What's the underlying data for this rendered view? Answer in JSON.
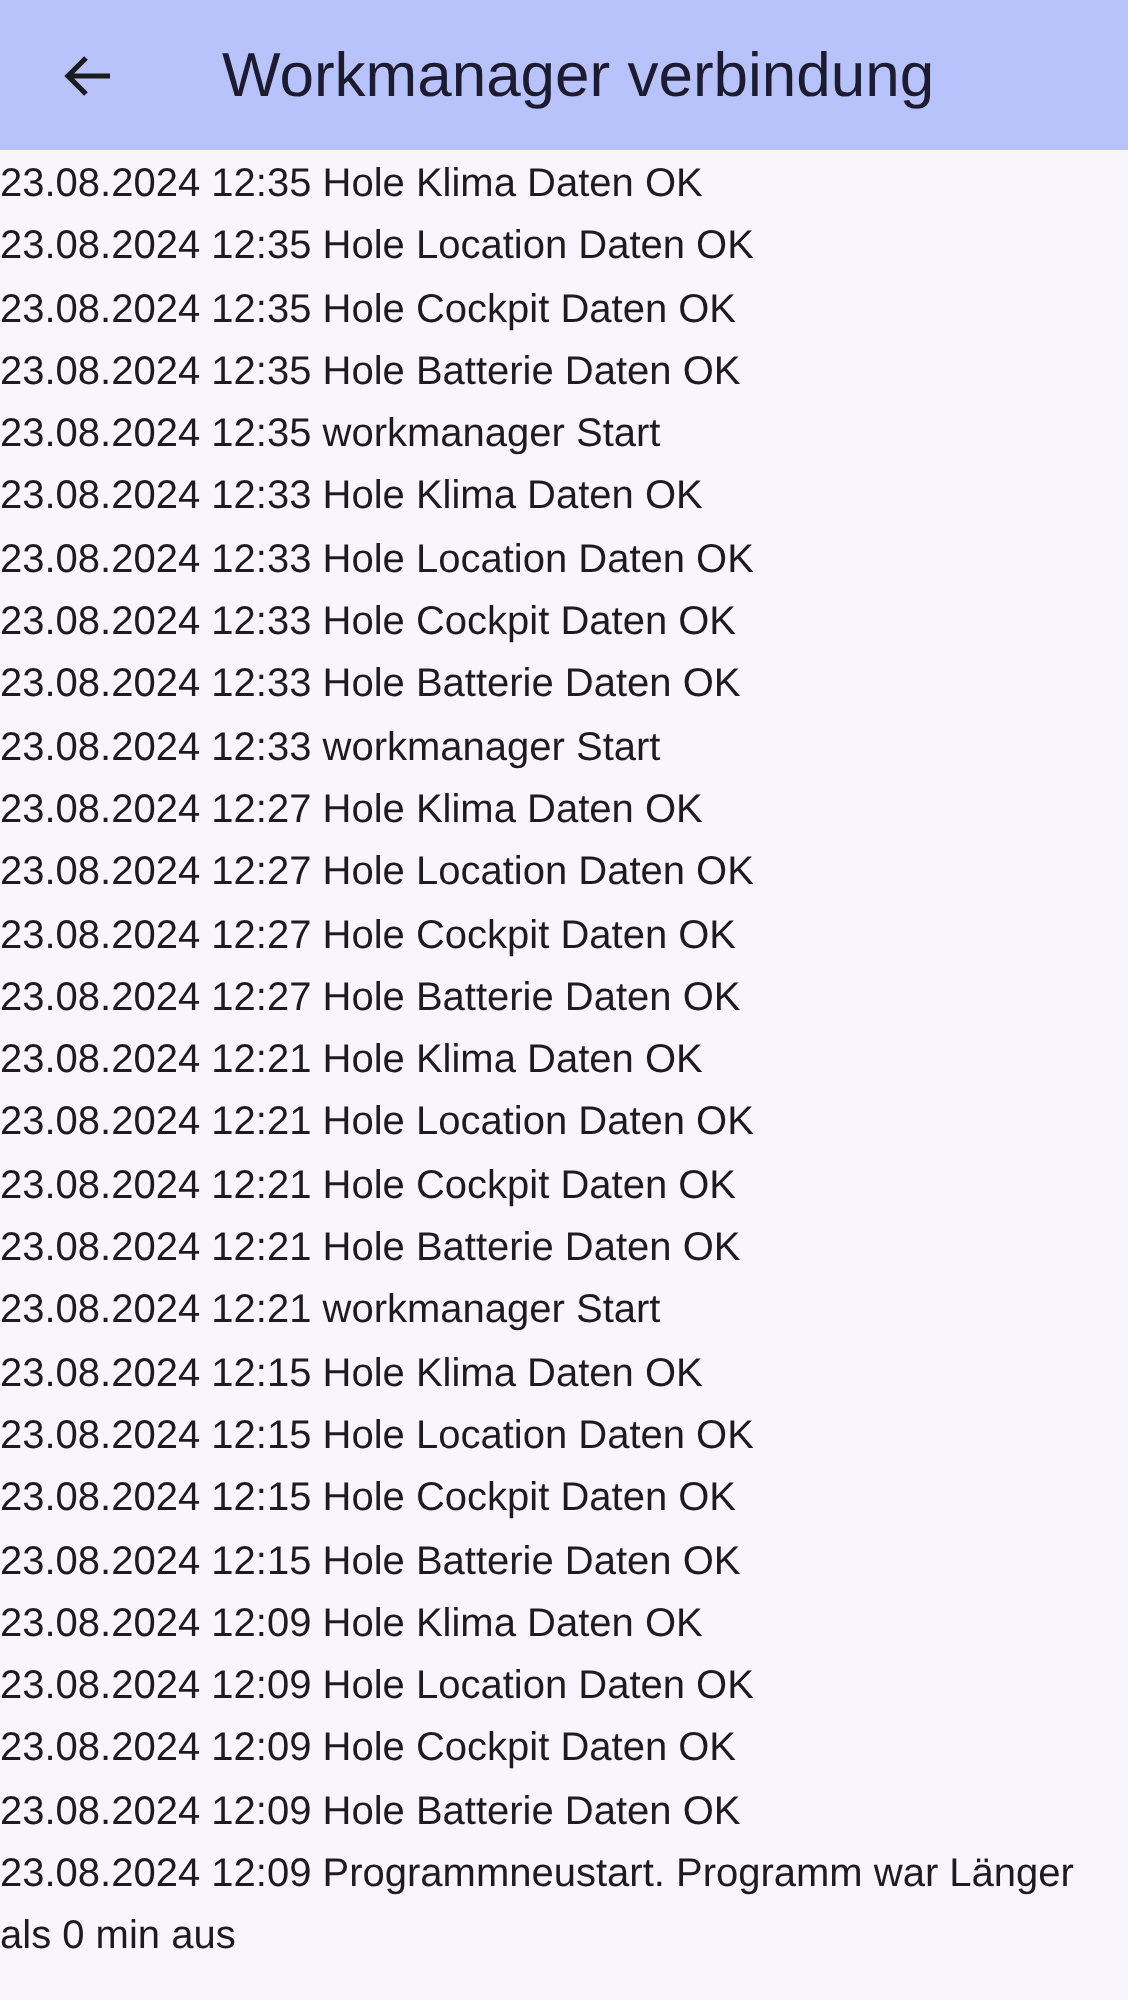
{
  "app_bar": {
    "title": "Workmanager verbindung"
  },
  "log": [
    "23.08.2024 12:35 Hole Klima Daten OK",
    "23.08.2024 12:35 Hole Location Daten OK",
    "23.08.2024 12:35 Hole Cockpit Daten OK",
    "23.08.2024 12:35 Hole Batterie Daten OK",
    "23.08.2024 12:35 workmanager Start",
    "23.08.2024 12:33 Hole Klima Daten OK",
    "23.08.2024 12:33 Hole Location Daten OK",
    "23.08.2024 12:33 Hole Cockpit Daten OK",
    "23.08.2024 12:33 Hole Batterie Daten OK",
    "23.08.2024 12:33 workmanager Start",
    "23.08.2024 12:27 Hole Klima Daten OK",
    "23.08.2024 12:27 Hole Location Daten OK",
    "23.08.2024 12:27 Hole Cockpit Daten OK",
    "23.08.2024 12:27 Hole Batterie Daten OK",
    "23.08.2024 12:21 Hole Klima Daten OK",
    "23.08.2024 12:21 Hole Location Daten OK",
    "23.08.2024 12:21 Hole Cockpit Daten OK",
    "23.08.2024 12:21 Hole Batterie Daten OK",
    "23.08.2024 12:21 workmanager Start",
    "23.08.2024 12:15 Hole Klima Daten OK",
    "23.08.2024 12:15 Hole Location Daten OK",
    "23.08.2024 12:15 Hole Cockpit Daten OK",
    "23.08.2024 12:15 Hole Batterie Daten OK",
    "23.08.2024 12:09 Hole Klima Daten OK",
    "23.08.2024 12:09 Hole Location Daten OK",
    "23.08.2024 12:09 Hole Cockpit Daten OK",
    "23.08.2024 12:09 Hole Batterie Daten OK",
    "23.08.2024 12:09 Programmneustart. Programm war Länger als 0 min aus"
  ]
}
